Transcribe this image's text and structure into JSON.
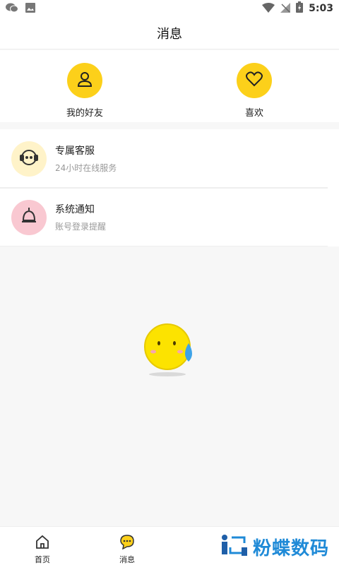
{
  "status_bar": {
    "time": "5:03"
  },
  "header": {
    "title": "消息"
  },
  "quick_actions": [
    {
      "label": "我的好友",
      "icon": "person-icon"
    },
    {
      "label": "喜欢",
      "icon": "heart-icon"
    }
  ],
  "messages": [
    {
      "title": "专属客服",
      "subtitle": "24小时在线服务",
      "icon": "customer-service-icon"
    },
    {
      "title": "系统通知",
      "subtitle": "账号登录提醒",
      "icon": "bell-icon"
    }
  ],
  "tabs": [
    {
      "label": "首页",
      "icon": "home-icon"
    },
    {
      "label": "消息",
      "icon": "chat-icon"
    }
  ],
  "watermark": {
    "text": "粉蝶数码"
  },
  "colors": {
    "accent_yellow": "#fcd01a",
    "service_bg": "#fff3c9",
    "notice_bg": "#f9c8d1",
    "watermark_blue": "#1f8ad7"
  }
}
